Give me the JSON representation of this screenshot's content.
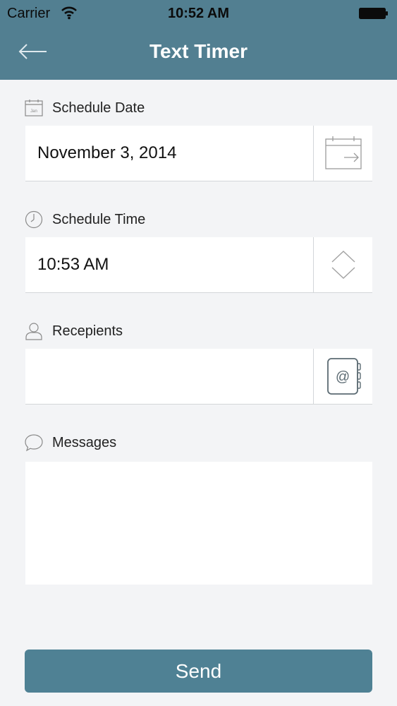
{
  "status_bar": {
    "carrier": "Carrier",
    "time": "10:52 AM"
  },
  "nav": {
    "title": "Text Timer"
  },
  "schedule_date": {
    "label": "Schedule Date",
    "icon_text": "Jan",
    "value": "November 3, 2014"
  },
  "schedule_time": {
    "label": "Schedule Time",
    "value": "10:53 AM"
  },
  "recipients": {
    "label": "Recepients",
    "value": ""
  },
  "messages": {
    "label": "Messages",
    "value": ""
  },
  "send": {
    "label": "Send"
  },
  "colors": {
    "header": "#527f91",
    "send_button": "#4f8194",
    "background": "#f3f4f6",
    "icon": "#8a8a8a"
  },
  "icons": [
    "wifi-icon",
    "battery-icon",
    "back-arrow-icon",
    "calendar-icon",
    "calendar-picker-icon",
    "clock-icon",
    "chevron-up-icon",
    "chevron-down-icon",
    "person-icon",
    "address-book-icon",
    "speech-bubble-icon"
  ]
}
